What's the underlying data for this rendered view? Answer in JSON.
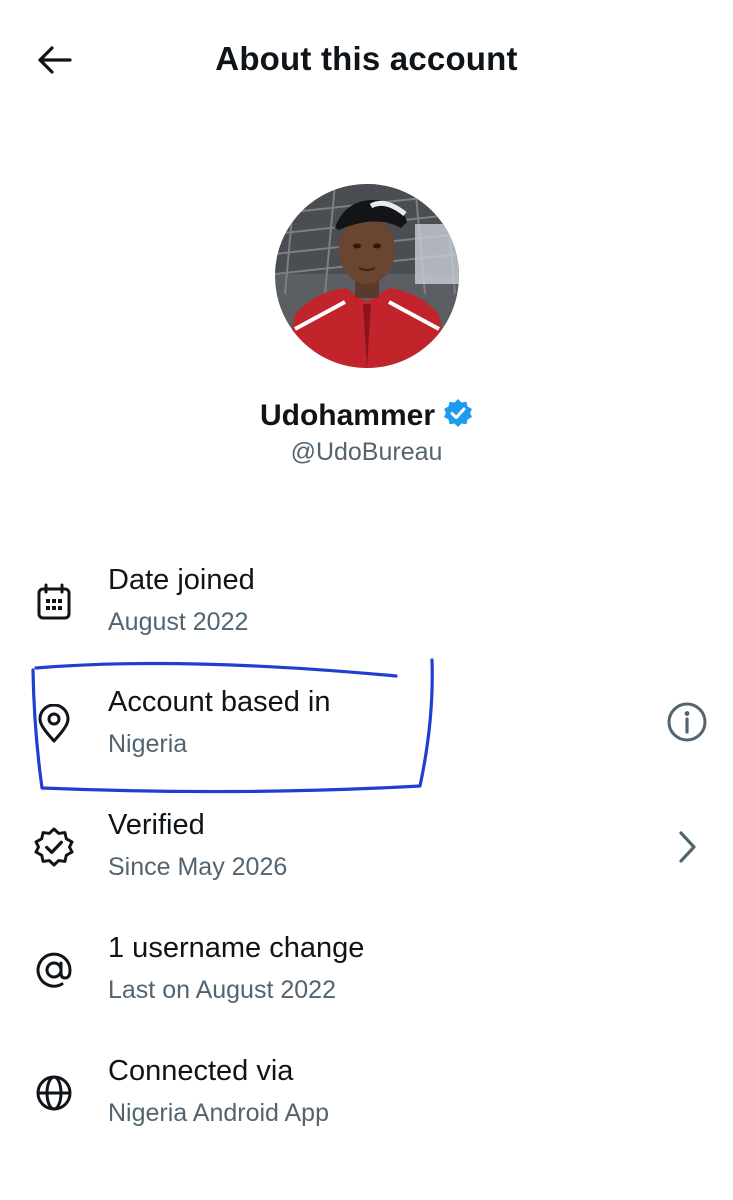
{
  "header": {
    "title": "About this account",
    "back_icon": "arrow-left-icon"
  },
  "profile": {
    "display_name": "Udohammer",
    "handle": "@UdoBureau",
    "verified": true,
    "verified_badge_color": "#1d9bf0"
  },
  "details": [
    {
      "icon": "calendar-icon",
      "title": "Date joined",
      "subtitle": "August 2022"
    },
    {
      "icon": "location-pin-icon",
      "title": "Account based in",
      "subtitle": "Nigeria",
      "action_icon": "info-icon",
      "highlighted": true
    },
    {
      "icon": "verified-badge-icon",
      "title": "Verified",
      "subtitle": "Since May 2026",
      "action_icon": "chevron-right-icon"
    },
    {
      "icon": "at-sign-icon",
      "title": "1 username change",
      "subtitle": "Last on August 2022"
    },
    {
      "icon": "globe-icon",
      "title": "Connected via",
      "subtitle": "Nigeria Android App"
    }
  ],
  "colors": {
    "text_primary": "#0f1419",
    "text_secondary": "#536471",
    "annotation_ink": "#1f3fd1"
  }
}
